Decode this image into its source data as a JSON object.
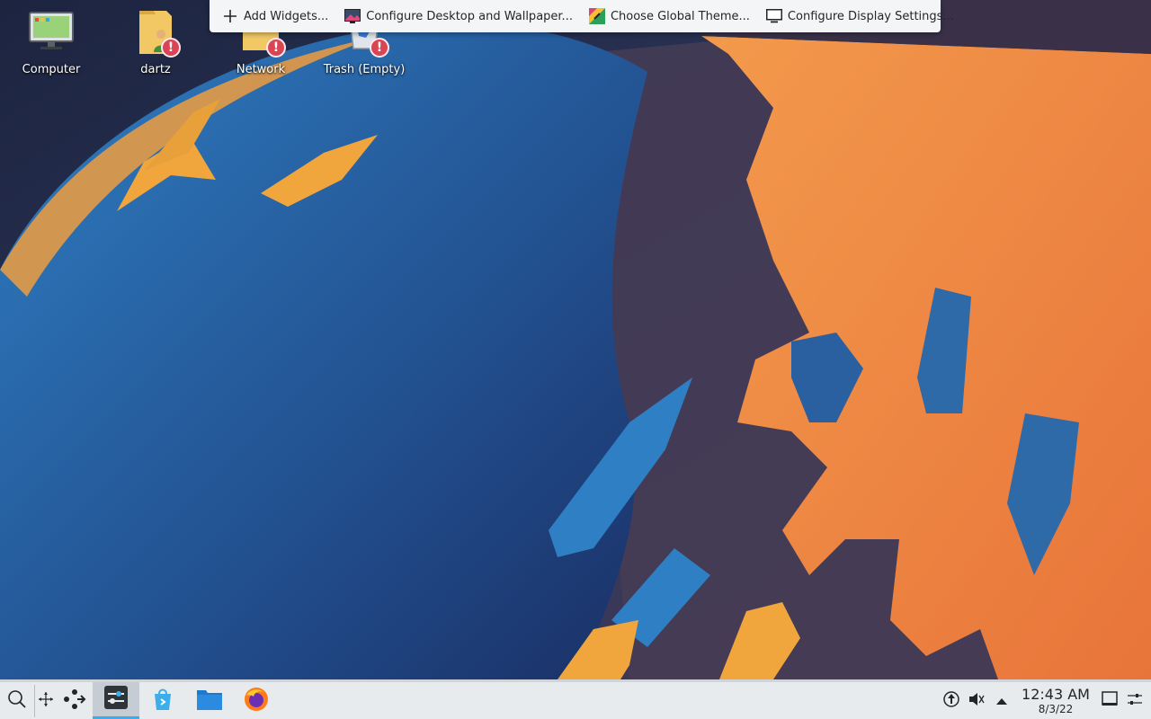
{
  "desktop": {
    "icons": [
      {
        "label": "Computer",
        "icon": "computer-icon"
      },
      {
        "label": "dartz",
        "icon": "user-folder-icon",
        "warning": true
      },
      {
        "label": "Network",
        "icon": "network-folder-icon",
        "warning": true
      },
      {
        "label": "Trash (Empty)",
        "icon": "trash-icon",
        "warning": true
      }
    ],
    "warning_glyph": "!"
  },
  "toolbar": {
    "items": [
      {
        "label": "Add Widgets...",
        "icon": "plus-icon"
      },
      {
        "label": "Configure Desktop and Wallpaper...",
        "icon": "wallpaper-icon"
      },
      {
        "label": "Choose Global Theme...",
        "icon": "theme-icon"
      },
      {
        "label": "Configure Display Settings...",
        "icon": "display-icon"
      }
    ]
  },
  "taskbar": {
    "launchers": [
      "search-icon",
      "move-icon",
      "share-icon"
    ],
    "tasks": [
      {
        "icon": "system-settings-icon",
        "active": true
      },
      {
        "icon": "discover-icon",
        "active": false
      },
      {
        "icon": "file-manager-icon",
        "active": false
      },
      {
        "icon": "firefox-icon",
        "active": false
      }
    ],
    "tray": {
      "clock_time": "12:43 AM",
      "clock_date": "8/3/22"
    }
  },
  "colors": {
    "accent": "#3daee9",
    "warning": "#da4453",
    "wallpaper_orange": "#f0883e",
    "wallpaper_blue": "#2a6db0"
  }
}
